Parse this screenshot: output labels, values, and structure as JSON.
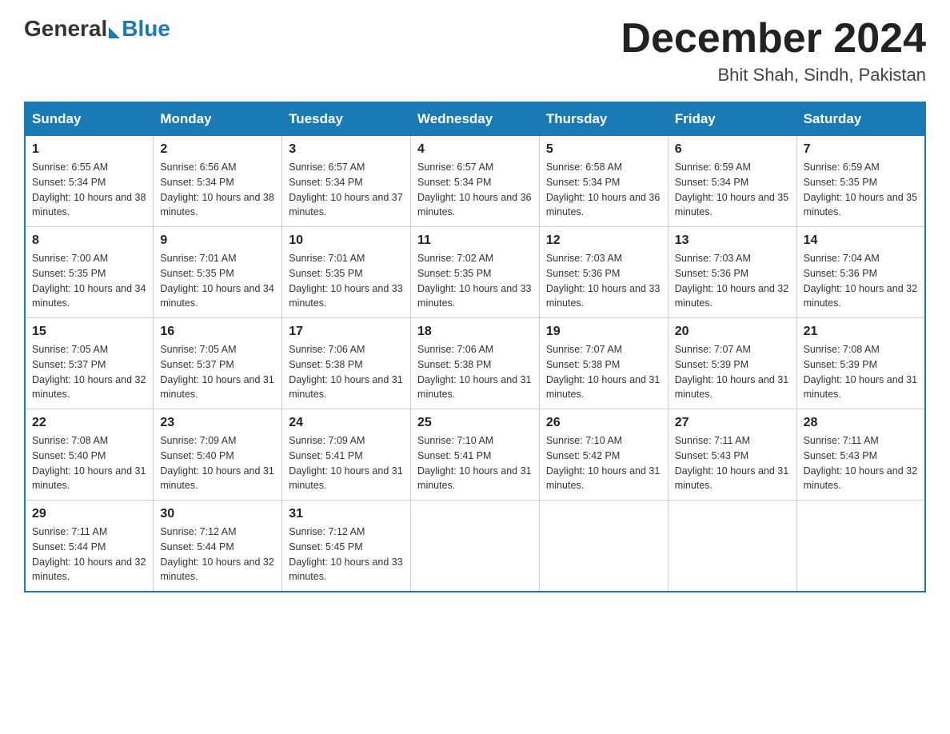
{
  "header": {
    "logo_general": "General",
    "logo_blue": "Blue",
    "month_title": "December 2024",
    "location": "Bhit Shah, Sindh, Pakistan"
  },
  "days_of_week": [
    "Sunday",
    "Monday",
    "Tuesday",
    "Wednesday",
    "Thursday",
    "Friday",
    "Saturday"
  ],
  "weeks": [
    [
      {
        "day": "1",
        "sunrise": "Sunrise: 6:55 AM",
        "sunset": "Sunset: 5:34 PM",
        "daylight": "Daylight: 10 hours and 38 minutes."
      },
      {
        "day": "2",
        "sunrise": "Sunrise: 6:56 AM",
        "sunset": "Sunset: 5:34 PM",
        "daylight": "Daylight: 10 hours and 38 minutes."
      },
      {
        "day": "3",
        "sunrise": "Sunrise: 6:57 AM",
        "sunset": "Sunset: 5:34 PM",
        "daylight": "Daylight: 10 hours and 37 minutes."
      },
      {
        "day": "4",
        "sunrise": "Sunrise: 6:57 AM",
        "sunset": "Sunset: 5:34 PM",
        "daylight": "Daylight: 10 hours and 36 minutes."
      },
      {
        "day": "5",
        "sunrise": "Sunrise: 6:58 AM",
        "sunset": "Sunset: 5:34 PM",
        "daylight": "Daylight: 10 hours and 36 minutes."
      },
      {
        "day": "6",
        "sunrise": "Sunrise: 6:59 AM",
        "sunset": "Sunset: 5:34 PM",
        "daylight": "Daylight: 10 hours and 35 minutes."
      },
      {
        "day": "7",
        "sunrise": "Sunrise: 6:59 AM",
        "sunset": "Sunset: 5:35 PM",
        "daylight": "Daylight: 10 hours and 35 minutes."
      }
    ],
    [
      {
        "day": "8",
        "sunrise": "Sunrise: 7:00 AM",
        "sunset": "Sunset: 5:35 PM",
        "daylight": "Daylight: 10 hours and 34 minutes."
      },
      {
        "day": "9",
        "sunrise": "Sunrise: 7:01 AM",
        "sunset": "Sunset: 5:35 PM",
        "daylight": "Daylight: 10 hours and 34 minutes."
      },
      {
        "day": "10",
        "sunrise": "Sunrise: 7:01 AM",
        "sunset": "Sunset: 5:35 PM",
        "daylight": "Daylight: 10 hours and 33 minutes."
      },
      {
        "day": "11",
        "sunrise": "Sunrise: 7:02 AM",
        "sunset": "Sunset: 5:35 PM",
        "daylight": "Daylight: 10 hours and 33 minutes."
      },
      {
        "day": "12",
        "sunrise": "Sunrise: 7:03 AM",
        "sunset": "Sunset: 5:36 PM",
        "daylight": "Daylight: 10 hours and 33 minutes."
      },
      {
        "day": "13",
        "sunrise": "Sunrise: 7:03 AM",
        "sunset": "Sunset: 5:36 PM",
        "daylight": "Daylight: 10 hours and 32 minutes."
      },
      {
        "day": "14",
        "sunrise": "Sunrise: 7:04 AM",
        "sunset": "Sunset: 5:36 PM",
        "daylight": "Daylight: 10 hours and 32 minutes."
      }
    ],
    [
      {
        "day": "15",
        "sunrise": "Sunrise: 7:05 AM",
        "sunset": "Sunset: 5:37 PM",
        "daylight": "Daylight: 10 hours and 32 minutes."
      },
      {
        "day": "16",
        "sunrise": "Sunrise: 7:05 AM",
        "sunset": "Sunset: 5:37 PM",
        "daylight": "Daylight: 10 hours and 31 minutes."
      },
      {
        "day": "17",
        "sunrise": "Sunrise: 7:06 AM",
        "sunset": "Sunset: 5:38 PM",
        "daylight": "Daylight: 10 hours and 31 minutes."
      },
      {
        "day": "18",
        "sunrise": "Sunrise: 7:06 AM",
        "sunset": "Sunset: 5:38 PM",
        "daylight": "Daylight: 10 hours and 31 minutes."
      },
      {
        "day": "19",
        "sunrise": "Sunrise: 7:07 AM",
        "sunset": "Sunset: 5:38 PM",
        "daylight": "Daylight: 10 hours and 31 minutes."
      },
      {
        "day": "20",
        "sunrise": "Sunrise: 7:07 AM",
        "sunset": "Sunset: 5:39 PM",
        "daylight": "Daylight: 10 hours and 31 minutes."
      },
      {
        "day": "21",
        "sunrise": "Sunrise: 7:08 AM",
        "sunset": "Sunset: 5:39 PM",
        "daylight": "Daylight: 10 hours and 31 minutes."
      }
    ],
    [
      {
        "day": "22",
        "sunrise": "Sunrise: 7:08 AM",
        "sunset": "Sunset: 5:40 PM",
        "daylight": "Daylight: 10 hours and 31 minutes."
      },
      {
        "day": "23",
        "sunrise": "Sunrise: 7:09 AM",
        "sunset": "Sunset: 5:40 PM",
        "daylight": "Daylight: 10 hours and 31 minutes."
      },
      {
        "day": "24",
        "sunrise": "Sunrise: 7:09 AM",
        "sunset": "Sunset: 5:41 PM",
        "daylight": "Daylight: 10 hours and 31 minutes."
      },
      {
        "day": "25",
        "sunrise": "Sunrise: 7:10 AM",
        "sunset": "Sunset: 5:41 PM",
        "daylight": "Daylight: 10 hours and 31 minutes."
      },
      {
        "day": "26",
        "sunrise": "Sunrise: 7:10 AM",
        "sunset": "Sunset: 5:42 PM",
        "daylight": "Daylight: 10 hours and 31 minutes."
      },
      {
        "day": "27",
        "sunrise": "Sunrise: 7:11 AM",
        "sunset": "Sunset: 5:43 PM",
        "daylight": "Daylight: 10 hours and 31 minutes."
      },
      {
        "day": "28",
        "sunrise": "Sunrise: 7:11 AM",
        "sunset": "Sunset: 5:43 PM",
        "daylight": "Daylight: 10 hours and 32 minutes."
      }
    ],
    [
      {
        "day": "29",
        "sunrise": "Sunrise: 7:11 AM",
        "sunset": "Sunset: 5:44 PM",
        "daylight": "Daylight: 10 hours and 32 minutes."
      },
      {
        "day": "30",
        "sunrise": "Sunrise: 7:12 AM",
        "sunset": "Sunset: 5:44 PM",
        "daylight": "Daylight: 10 hours and 32 minutes."
      },
      {
        "day": "31",
        "sunrise": "Sunrise: 7:12 AM",
        "sunset": "Sunset: 5:45 PM",
        "daylight": "Daylight: 10 hours and 33 minutes."
      },
      null,
      null,
      null,
      null
    ]
  ]
}
